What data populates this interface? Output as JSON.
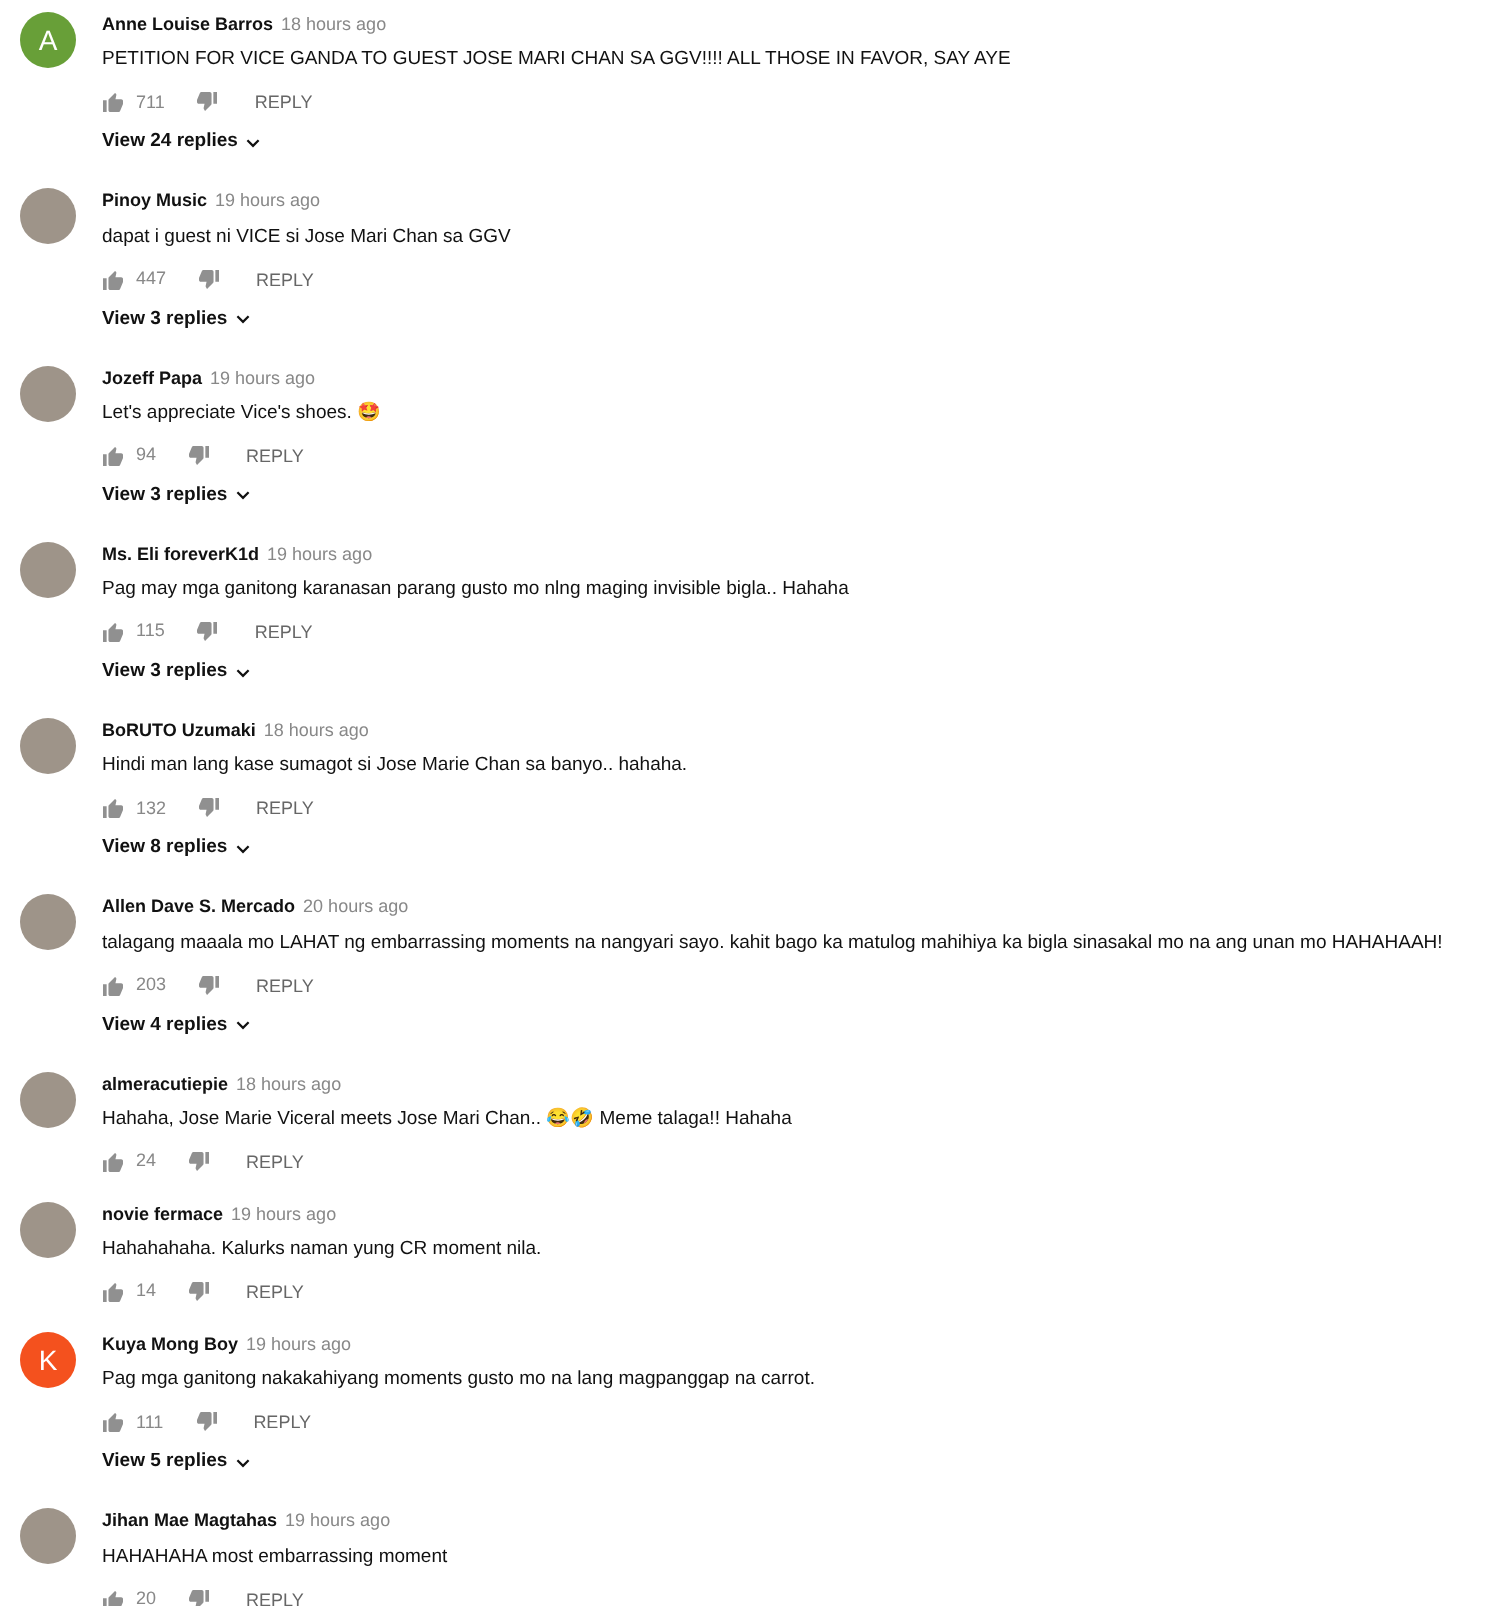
{
  "comments": [
    {
      "author": "Anne Louise Barros",
      "time": "18 hours ago",
      "text": "PETITION FOR VICE GANDA TO GUEST JOSE MARI CHAN SA GGV!!!! ALL THOSE IN FAVOR, SAY AYE",
      "likes": "711",
      "reply": "REPLY",
      "replies": "View 24 replies",
      "avatar": {
        "kind": "letter",
        "letter": "A",
        "color": "#689f38"
      }
    },
    {
      "author": "Pinoy Music",
      "time": "19 hours ago",
      "text": "dapat i guest ni VICE si Jose Mari Chan sa GGV",
      "likes": "447",
      "reply": "REPLY",
      "replies": "View 3 replies",
      "avatar": {
        "kind": "photo"
      }
    },
    {
      "author": "Jozeff Papa",
      "time": "19 hours ago",
      "text": "Let's appreciate Vice's shoes. 🤩",
      "likes": "94",
      "reply": "REPLY",
      "replies": "View 3 replies",
      "avatar": {
        "kind": "photo"
      }
    },
    {
      "author": "Ms. Eli foreverK1d",
      "time": "19 hours ago",
      "text": "Pag may mga ganitong karanasan parang gusto mo nlng maging invisible bigla.. Hahaha",
      "likes": "115",
      "reply": "REPLY",
      "replies": "View 3 replies",
      "avatar": {
        "kind": "photo"
      }
    },
    {
      "author": "BoRUTO Uzumaki",
      "time": "18 hours ago",
      "text": "Hindi man lang kase sumagot si Jose Marie Chan sa banyo.. hahaha.",
      "likes": "132",
      "reply": "REPLY",
      "replies": "View 8 replies",
      "avatar": {
        "kind": "photo"
      }
    },
    {
      "author": "Allen Dave S. Mercado",
      "time": "20 hours ago",
      "text": "talagang maaala mo LAHAT ng embarrassing moments na nangyari sayo. kahit bago ka matulog mahihiya ka bigla sinasakal mo na ang unan mo HAHAHAAH!",
      "likes": "203",
      "reply": "REPLY",
      "replies": "View 4 replies",
      "avatar": {
        "kind": "photo"
      }
    },
    {
      "author": "almeracutiepie",
      "time": "18 hours ago",
      "text": "Hahaha, Jose Marie Viceral meets Jose Mari Chan.. 😂🤣 Meme talaga!! Hahaha",
      "likes": "24",
      "reply": "REPLY",
      "avatar": {
        "kind": "photo"
      }
    },
    {
      "author": "novie fermace",
      "time": "19 hours ago",
      "text": "Hahahahaha. Kalurks naman yung CR moment nila.",
      "likes": "14",
      "reply": "REPLY",
      "avatar": {
        "kind": "photo"
      }
    },
    {
      "author": "Kuya Mong Boy",
      "time": "19 hours ago",
      "text": "Pag mga ganitong nakakahiyang moments gusto mo na lang magpanggap na carrot.",
      "likes": "111",
      "reply": "REPLY",
      "replies": "View 5 replies",
      "avatar": {
        "kind": "letter",
        "letter": "K",
        "color": "#f4511e"
      }
    },
    {
      "author": "Jihan Mae Magtahas",
      "time": "19 hours ago",
      "text": "HAHAHAHA most embarrassing moment",
      "likes": "20",
      "reply": "REPLY",
      "avatar": {
        "kind": "photo"
      }
    }
  ]
}
